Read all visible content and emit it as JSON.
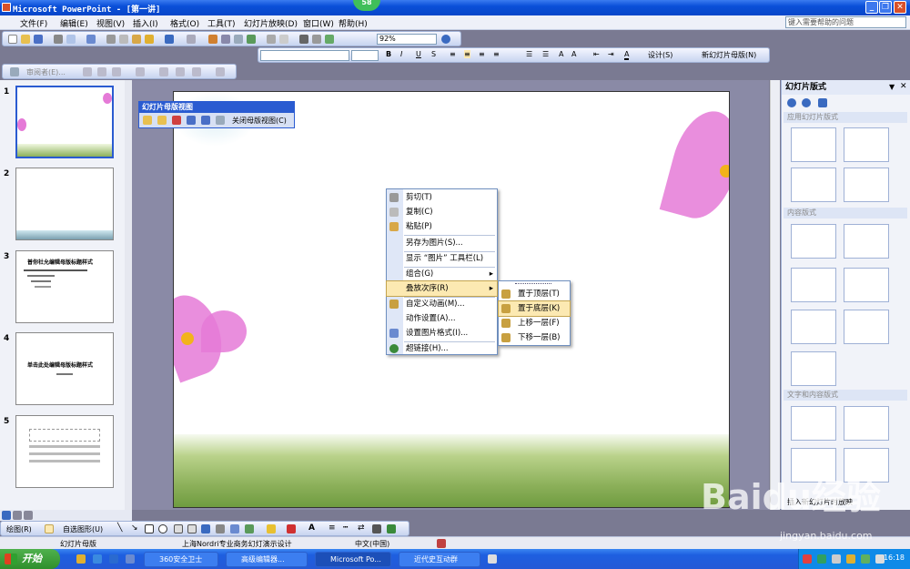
{
  "window": {
    "title": "Microsoft PowerPoint - [第一讲]",
    "badge": "58"
  },
  "menu": {
    "items": [
      "文件(F)",
      "编辑(E)",
      "视图(V)",
      "插入(I)",
      "格式(O)",
      "工具(T)",
      "幻灯片放映(D)",
      "窗口(W)",
      "帮助(H)"
    ],
    "help_placeholder": "键入需要帮助的问题"
  },
  "toolbar": {
    "zoom": "92%",
    "design_label": "设计(S)",
    "new_master_label": "新幻灯片母版(N)",
    "reviewer_label": "审阅者(E)..."
  },
  "slides": {
    "numbers": [
      "1",
      "2",
      "3",
      "4",
      "5"
    ],
    "slide3_title": "普你社允编辑母版标题样式",
    "slide4_title": "单击此处编辑母版标题样式"
  },
  "master_toolbar": {
    "title": "幻灯片母版视图",
    "close": "关闭母版视图(C)"
  },
  "context_menu": {
    "items": [
      "剪切(T)",
      "复制(C)",
      "粘贴(P)",
      "另存为图片(S)...",
      "显示 “图片” 工具栏(L)",
      "组合(G)",
      "叠放次序(R)",
      "自定义动画(M)...",
      "动作设置(A)...",
      "设置图片格式(I)...",
      "超链接(H)..."
    ],
    "highlighted": "叠放次序(R)"
  },
  "submenu": {
    "items": [
      "置于顶层(T)",
      "置于底层(K)",
      "上移一层(F)",
      "下移一层(B)"
    ],
    "highlighted": "置于底层(K)"
  },
  "task_pane": {
    "title": "幻灯片版式",
    "section1": "应用幻灯片版式",
    "section2": "内容版式",
    "section3": "文字和内容版式",
    "footer": "插入新幻灯片时放映"
  },
  "drawing": {
    "draw_label": "绘图(R)",
    "autoshape_label": "自选图形(U)"
  },
  "status": {
    "view": "幻灯片母版",
    "template": "上海Nordri专业商务幻灯演示设计",
    "language": "中文(中国)"
  },
  "taskbar": {
    "start": "开始",
    "tasks": [
      "360安全卫士",
      "高级编辑器...",
      "Microsoft Po...",
      "近代史互动群"
    ],
    "clock": "16:18"
  },
  "watermark": {
    "text": "Baidu经验",
    "url": "jingyan.baidu.com"
  },
  "colors": {
    "title_blue": "#0a4fd8",
    "highlight": "#fce9b2",
    "taskbar": "#2459d6",
    "start_green": "#2f8f2c"
  }
}
